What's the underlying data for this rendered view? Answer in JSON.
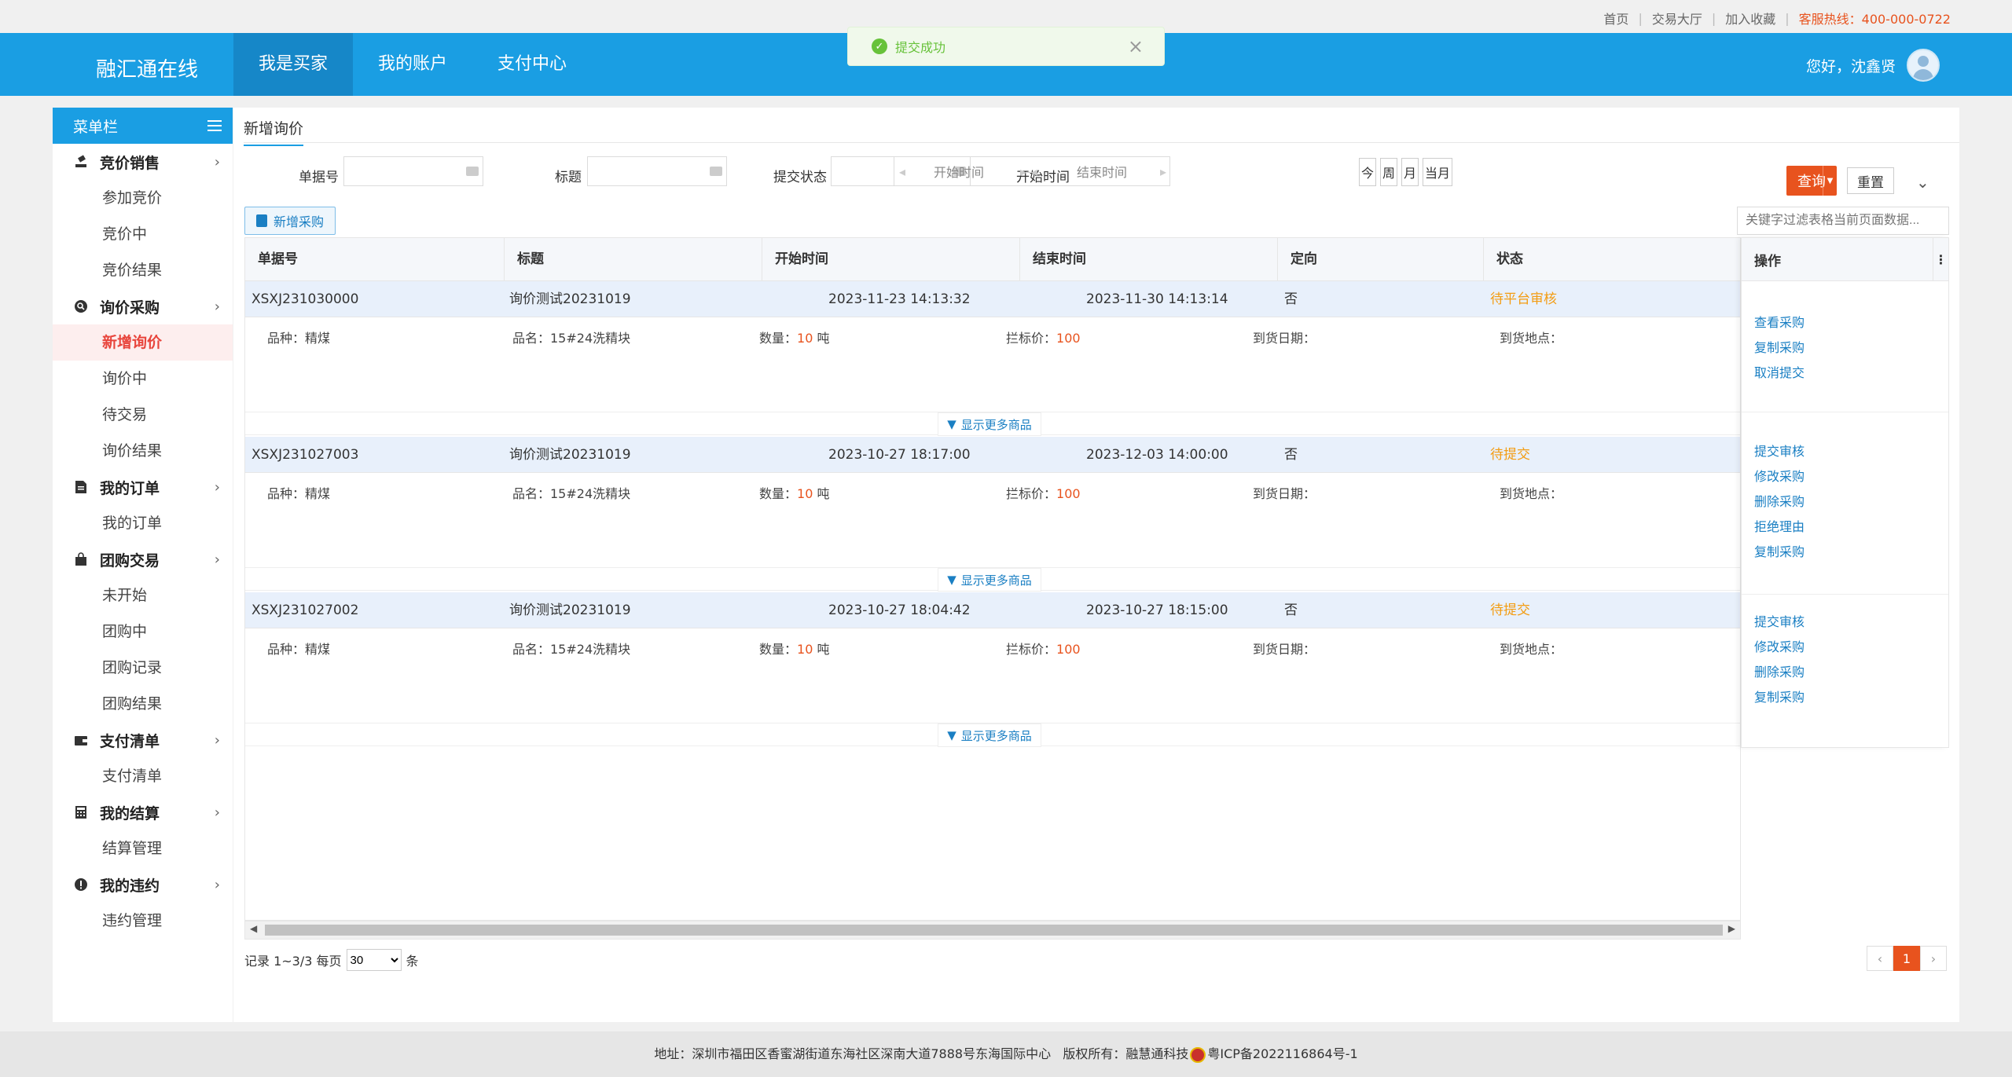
{
  "topbar": {
    "links": [
      "首页",
      "交易大厅",
      "加入收藏"
    ],
    "hotline": "客服热线：400-000-0722"
  },
  "header": {
    "brand": "融汇通在线",
    "nav": [
      "我是买家",
      "我的账户",
      "支付中心"
    ],
    "greeting": "您好，沈鑫贤"
  },
  "toast": {
    "message": "提交成功"
  },
  "sidebar": {
    "title": "菜单栏",
    "groups": [
      {
        "label": "竞价销售",
        "items": [
          "参加竞价",
          "竞价中",
          "竞价结果"
        ]
      },
      {
        "label": "询价采购",
        "items": [
          "新增询价",
          "询价中",
          "待交易",
          "询价结果"
        ]
      },
      {
        "label": "我的订单",
        "items": [
          "我的订单"
        ]
      },
      {
        "label": "团购交易",
        "items": [
          "未开始",
          "团购中",
          "团购记录",
          "团购结果"
        ]
      },
      {
        "label": "支付清单",
        "items": [
          "支付清单"
        ]
      },
      {
        "label": "我的结算",
        "items": [
          "结算管理"
        ]
      },
      {
        "label": "我的违约",
        "items": [
          "违约管理"
        ]
      }
    ]
  },
  "main": {
    "tab": "新增询价",
    "filter": {
      "doc_no_label": "单据号",
      "title_label": "标题",
      "status_label": "提交状态",
      "time_label": "开始时间",
      "start_placeholder": "开始时间",
      "end_placeholder": "结束时间",
      "quick": [
        "今",
        "周",
        "月",
        "当月"
      ],
      "search": "查询",
      "reset": "重置"
    },
    "add_button": "新增采购",
    "keyword_placeholder": "关键字过滤表格当前页面数据...",
    "columns": [
      "单据号",
      "标题",
      "开始时间",
      "结束时间",
      "定向",
      "状态",
      "操作"
    ],
    "rows": [
      {
        "no": "XSXJ231030000",
        "title": "询价测试20231019",
        "start": "2023-11-23 14:13:32",
        "end": "2023-11-30 14:13:14",
        "directed": "否",
        "status": "待平台审核",
        "variety": "品种：精煤",
        "name": "品名：15#24洗精块",
        "qty_label": "数量：",
        "qty": "10",
        "qty_unit": "吨",
        "price_label": "拦标价：",
        "price": "100",
        "arrive_date": "到货日期：",
        "arrive_place": "到货地点：",
        "more": "显示更多商品",
        "ops": [
          "查看采购",
          "复制采购",
          "取消提交"
        ]
      },
      {
        "no": "XSXJ231027003",
        "title": "询价测试20231019",
        "start": "2023-10-27 18:17:00",
        "end": "2023-12-03 14:00:00",
        "directed": "否",
        "status": "待提交",
        "variety": "品种：精煤",
        "name": "品名：15#24洗精块",
        "qty_label": "数量：",
        "qty": "10",
        "qty_unit": "吨",
        "price_label": "拦标价：",
        "price": "100",
        "arrive_date": "到货日期：",
        "arrive_place": "到货地点：",
        "more": "显示更多商品",
        "ops": [
          "提交审核",
          "修改采购",
          "删除采购",
          "拒绝理由",
          "复制采购"
        ]
      },
      {
        "no": "XSXJ231027002",
        "title": "询价测试20231019",
        "start": "2023-10-27 18:04:42",
        "end": "2023-10-27 18:15:00",
        "directed": "否",
        "status": "待提交",
        "variety": "品种：精煤",
        "name": "品名：15#24洗精块",
        "qty_label": "数量：",
        "qty": "10",
        "qty_unit": "吨",
        "price_label": "拦标价：",
        "price": "100",
        "arrive_date": "到货日期：",
        "arrive_place": "到货地点：",
        "more": "显示更多商品",
        "ops": [
          "提交审核",
          "修改采购",
          "删除采购",
          "复制采购"
        ]
      }
    ],
    "pager": {
      "records": "记录 1~3/3 每页",
      "per_page": "30",
      "unit": "条",
      "current": "1",
      "prev": "‹",
      "next": "›"
    }
  },
  "footer": {
    "address": "地址：深圳市福田区香蜜湖街道东海社区深南大道7888号东海国际中心",
    "copyright": "版权所有：融慧通科技",
    "icp": "粤ICP备2022116864号-1"
  },
  "colors": {
    "primary": "#1a9ee3",
    "accent": "#e8531e",
    "status_pending": "#f39c12",
    "link": "#1a7fc3"
  }
}
